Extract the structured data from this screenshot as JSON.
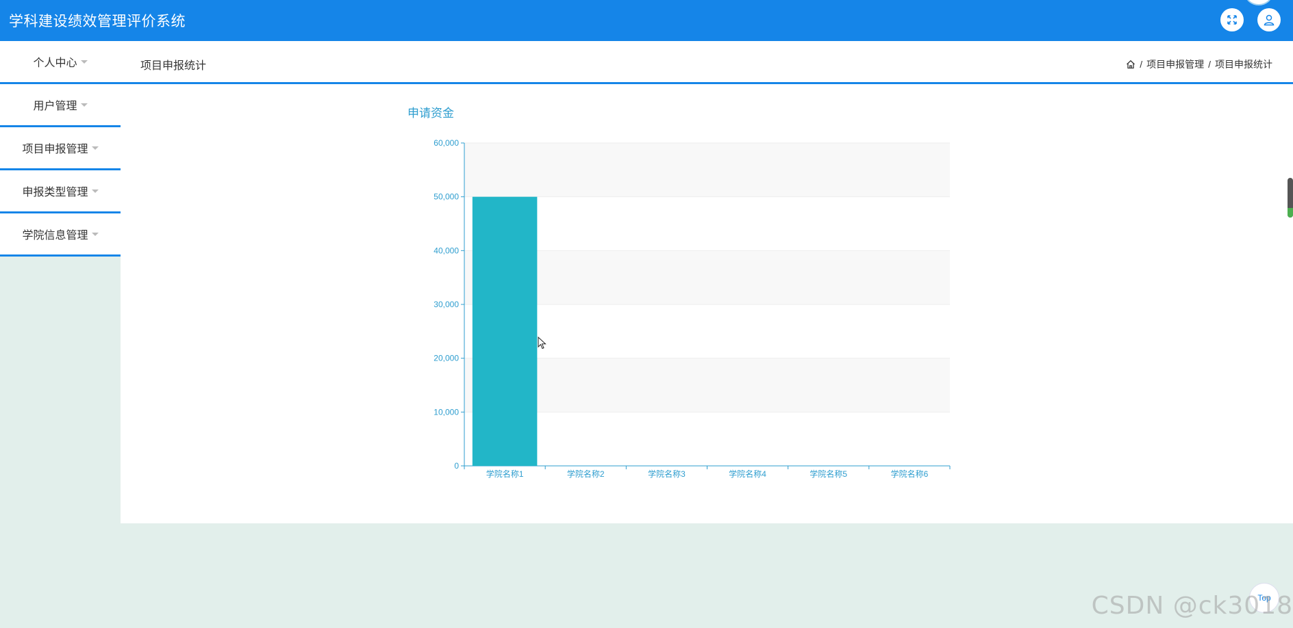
{
  "app": {
    "title": "学科建设绩效管理评价系统"
  },
  "header": {
    "icons": [
      "fullscreen-icon",
      "user-icon"
    ]
  },
  "sidebar": {
    "items": [
      {
        "label": "个人中心"
      },
      {
        "label": "用户管理"
      },
      {
        "label": "项目申报管理"
      },
      {
        "label": "申报类型管理"
      },
      {
        "label": "学院信息管理"
      }
    ]
  },
  "topbar": {
    "tab": "项目申报统计",
    "breadcrumb": {
      "sep": "/",
      "level1": "项目申报管理",
      "level2": "项目申报统计"
    }
  },
  "chart_data": {
    "type": "bar",
    "title": "申请资金",
    "categories": [
      "学院名称1",
      "学院名称2",
      "学院名称3",
      "学院名称4",
      "学院名称5",
      "学院名称6"
    ],
    "values": [
      50000,
      0,
      0,
      0,
      0,
      0
    ],
    "ylim": [
      0,
      60000
    ],
    "yticks": [
      "0",
      "10,000",
      "20,000",
      "30,000",
      "40,000",
      "50,000",
      "60,000"
    ],
    "xlabel": "",
    "ylabel": "",
    "grid": true,
    "colors": {
      "bar": "#22b6c8",
      "axis": "#2d9dcf",
      "band": "#f8f8f8"
    }
  },
  "back_top": {
    "label": "Top"
  },
  "watermark": {
    "text": "CSDN @ck3018"
  }
}
